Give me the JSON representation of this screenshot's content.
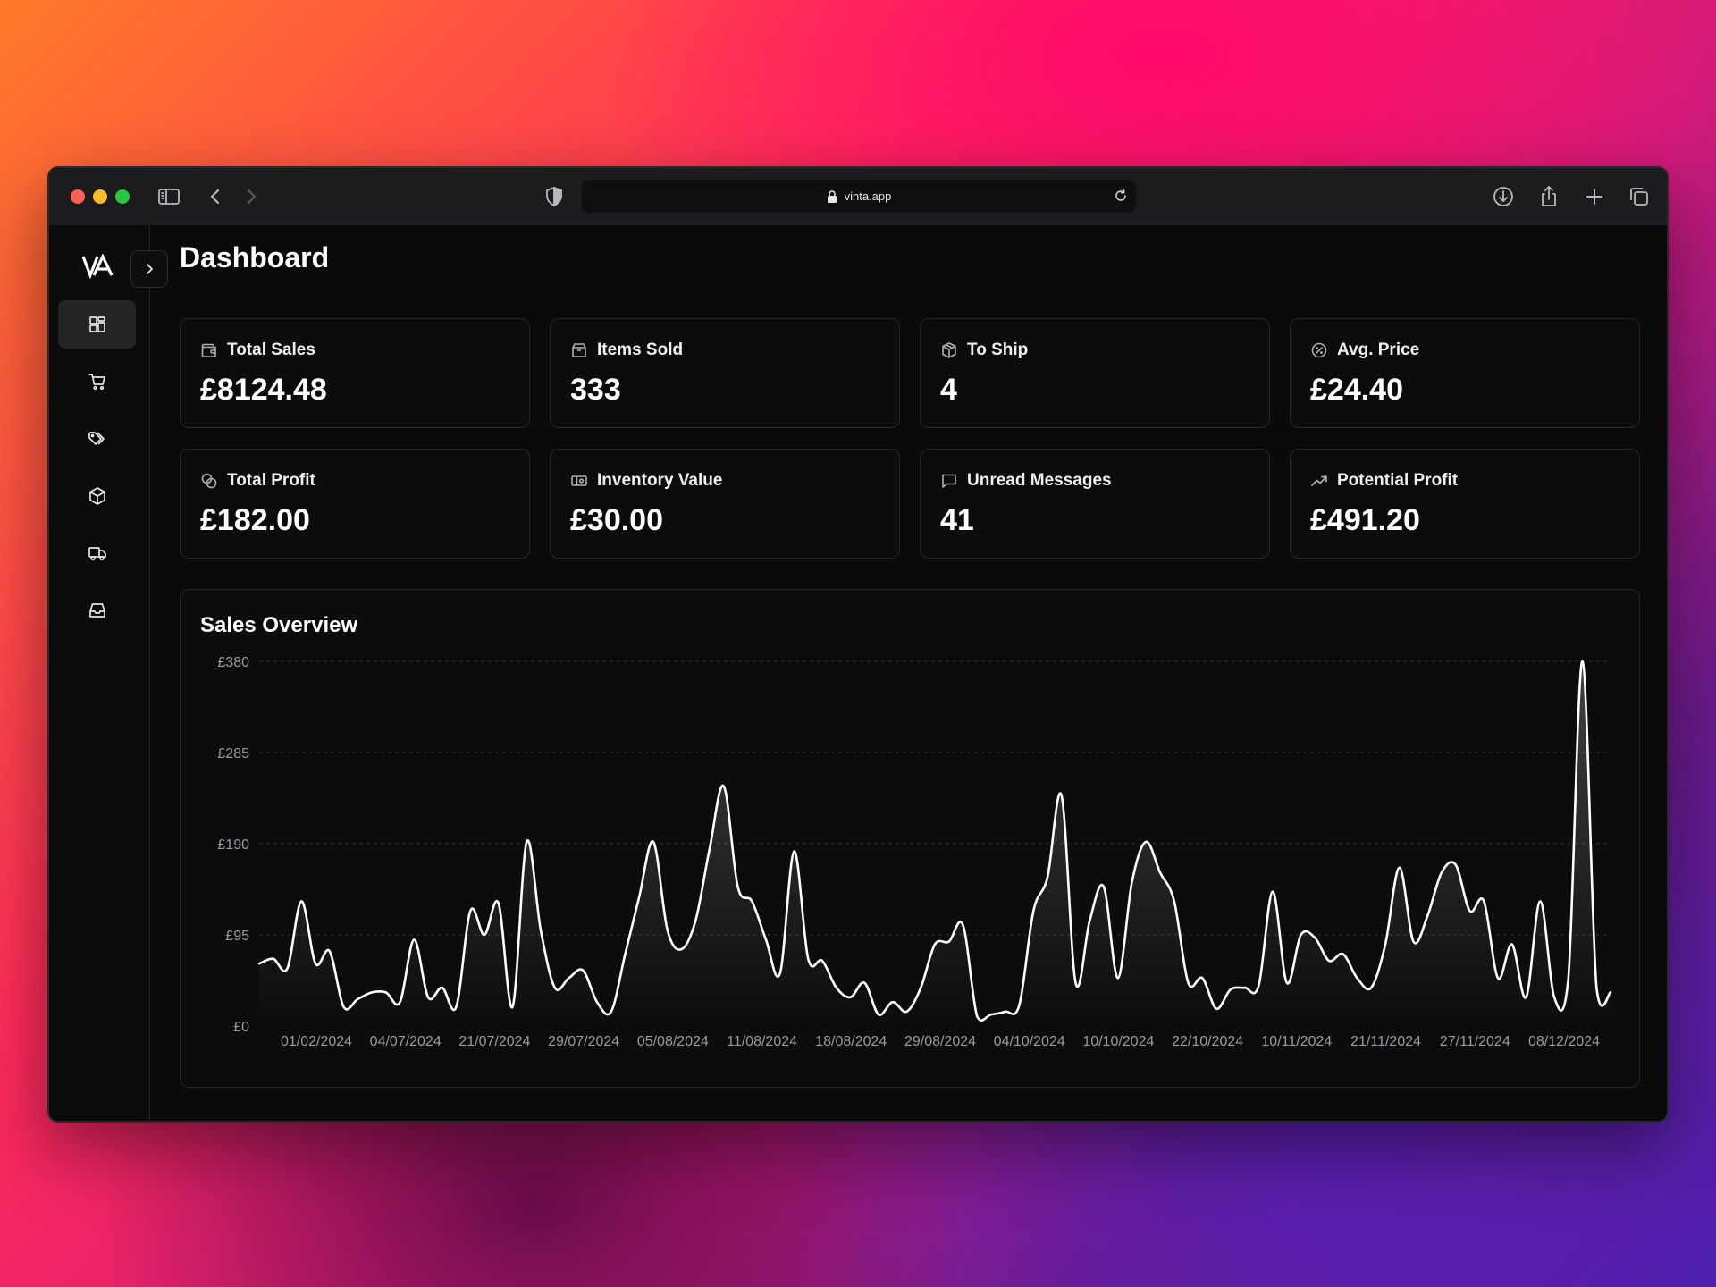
{
  "browser": {
    "url": "vinta.app",
    "traffic_colors": [
      "#ff5f57",
      "#febc2e",
      "#28c840"
    ]
  },
  "sidebar": {
    "items": [
      {
        "name": "dashboard",
        "icon": "grid-icon",
        "active": true
      },
      {
        "name": "orders",
        "icon": "cart-icon",
        "active": false
      },
      {
        "name": "listings",
        "icon": "tags-icon",
        "active": false
      },
      {
        "name": "inventory",
        "icon": "box-icon",
        "active": false
      },
      {
        "name": "shipping",
        "icon": "truck-icon",
        "active": false
      },
      {
        "name": "inbox",
        "icon": "inbox-icon",
        "active": false
      }
    ]
  },
  "page": {
    "title": "Dashboard"
  },
  "stats": [
    {
      "label": "Total Sales",
      "value": "£8124.48",
      "icon": "wallet-icon"
    },
    {
      "label": "Items Sold",
      "value": "333",
      "icon": "package-icon"
    },
    {
      "label": "To Ship",
      "value": "4",
      "icon": "shipping-box-icon"
    },
    {
      "label": "Avg. Price",
      "value": "£24.40",
      "icon": "badge-percent-icon"
    },
    {
      "label": "Total Profit",
      "value": "£182.00",
      "icon": "coins-icon"
    },
    {
      "label": "Inventory Value",
      "value": "£30.00",
      "icon": "banknote-icon"
    },
    {
      "label": "Unread Messages",
      "value": "41",
      "icon": "message-icon"
    },
    {
      "label": "Potential Profit",
      "value": "£491.20",
      "icon": "trending-up-icon"
    }
  ],
  "chart_title": "Sales Overview",
  "colors": {
    "line": "#ffffff",
    "grid": "#3a3a3e",
    "background": "#0a0a0b"
  },
  "chart_data": {
    "type": "area",
    "title": "Sales Overview",
    "xlabel": "",
    "ylabel": "",
    "grid": true,
    "ylim": [
      0,
      380
    ],
    "yticks": [
      "£0",
      "£95",
      "£190",
      "£285",
      "£380"
    ],
    "ytick_values": [
      0,
      95,
      190,
      285,
      380
    ],
    "xtick_labels": [
      "01/02/2024",
      "04/07/2024",
      "21/07/2024",
      "29/07/2024",
      "05/08/2024",
      "11/08/2024",
      "18/08/2024",
      "29/08/2024",
      "04/10/2024",
      "10/10/2024",
      "22/10/2024",
      "10/11/2024",
      "21/11/2024",
      "27/11/2024",
      "08/12/2024"
    ],
    "values": [
      65,
      70,
      60,
      130,
      65,
      78,
      20,
      28,
      35,
      35,
      25,
      90,
      30,
      40,
      20,
      120,
      95,
      128,
      20,
      192,
      100,
      40,
      50,
      58,
      25,
      15,
      75,
      135,
      192,
      100,
      80,
      110,
      185,
      250,
      145,
      130,
      90,
      55,
      182,
      70,
      68,
      40,
      30,
      45,
      12,
      25,
      15,
      40,
      85,
      88,
      105,
      10,
      12,
      15,
      22,
      120,
      155,
      240,
      45,
      110,
      145,
      50,
      150,
      192,
      160,
      130,
      45,
      50,
      18,
      38,
      40,
      42,
      140,
      45,
      95,
      92,
      68,
      75,
      50,
      40,
      85,
      165,
      88,
      115,
      160,
      168,
      120,
      130,
      50,
      85,
      30,
      130,
      30,
      50,
      380,
      40,
      35
    ]
  }
}
